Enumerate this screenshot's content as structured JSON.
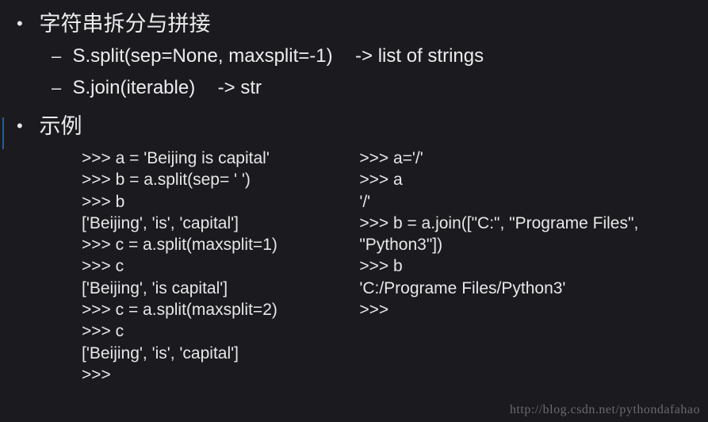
{
  "sections": {
    "title1": "字符串拆分与拼接",
    "title2": "示例",
    "sub": [
      {
        "method": "S.split(sep=None, maxsplit=-1)",
        "ret": "-> list of strings"
      },
      {
        "method": "S.join(iterable)",
        "ret": "-> str"
      }
    ]
  },
  "code": {
    "left": [
      ">>> a = 'Beijing is capital'",
      ">>> b = a.split(sep= ' ')",
      ">>> b",
      "['Beijing', 'is', 'capital']",
      ">>> c = a.split(maxsplit=1)",
      ">>> c",
      "['Beijing', 'is capital']",
      ">>> c = a.split(maxsplit=2)",
      ">>> c",
      "['Beijing', 'is', 'capital']",
      ">>>"
    ],
    "right": [
      ">>> a='/'",
      ">>> a",
      "'/'",
      ">>> b = a.join([\"C:\", \"Programe Files\",",
      "\"Python3\"])",
      ">>> b",
      "'C:/Programe Files/Python3'",
      ">>>"
    ]
  },
  "watermark": "http://blog.csdn.net/pythondafahao"
}
